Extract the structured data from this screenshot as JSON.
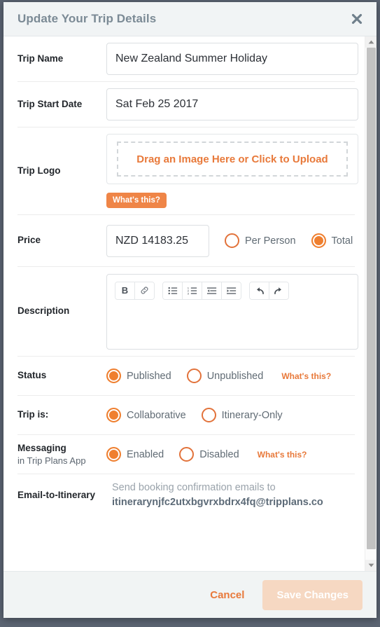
{
  "header": {
    "title": "Update Your Trip Details",
    "close_icon": "close-icon"
  },
  "colors": {
    "accent_orange": "#ef7f2f",
    "link_orange": "#e8793a",
    "badge_orange": "#ef8547",
    "title_grey": "#7b8a95",
    "label_dark": "#22262b",
    "save_disabled": "#f6d8c2"
  },
  "fields": {
    "trip_name": {
      "label": "Trip Name",
      "value": "New Zealand Summer Holiday",
      "placeholder": "Trip Name"
    },
    "trip_start_date": {
      "label": "Trip Start Date",
      "value": "Sat Feb 25 2017",
      "placeholder": "Trip Start Date"
    },
    "trip_logo": {
      "label": "Trip Logo",
      "upload_text": "Drag an Image Here or Click to Upload",
      "badge": "What's this?"
    },
    "price": {
      "label": "Price",
      "value": "NZD 14183.25",
      "placeholder": "Price",
      "options": [
        {
          "label": "Per Person",
          "selected": false
        },
        {
          "label": "Total",
          "selected": true
        }
      ]
    },
    "description": {
      "label": "Description",
      "value": "",
      "toolbar": [
        {
          "name": "bold-icon",
          "glyph": "B"
        },
        {
          "name": "link-icon",
          "glyph": "⚭"
        },
        {
          "name": "unordered-list-icon",
          "glyph": "☰"
        },
        {
          "name": "ordered-list-icon",
          "glyph": "☰"
        },
        {
          "name": "outdent-icon",
          "glyph": "☰"
        },
        {
          "name": "indent-icon",
          "glyph": "☰"
        },
        {
          "name": "undo-icon",
          "glyph": "↶"
        },
        {
          "name": "redo-icon",
          "glyph": "↷"
        }
      ]
    },
    "status": {
      "label": "Status",
      "options": [
        {
          "label": "Published",
          "selected": true
        },
        {
          "label": "Unpublished",
          "selected": false
        }
      ],
      "help_link": "What's this?"
    },
    "trip_is": {
      "label": "Trip is:",
      "options": [
        {
          "label": "Collaborative",
          "selected": true
        },
        {
          "label": "Itinerary-Only",
          "selected": false
        }
      ]
    },
    "messaging": {
      "label": "Messaging",
      "sublabel": "in Trip Plans App",
      "options": [
        {
          "label": "Enabled",
          "selected": true
        },
        {
          "label": "Disabled",
          "selected": false
        }
      ],
      "help_link": "What's this?"
    },
    "email_to_itinerary": {
      "label": "Email-to-Itinerary",
      "lead": "Send booking confirmation emails to",
      "address": "itinerarynjfc2utxbgvrxbdrx4fq@tripplans.co"
    }
  },
  "footer": {
    "cancel_label": "Cancel",
    "save_label": "Save Changes"
  }
}
